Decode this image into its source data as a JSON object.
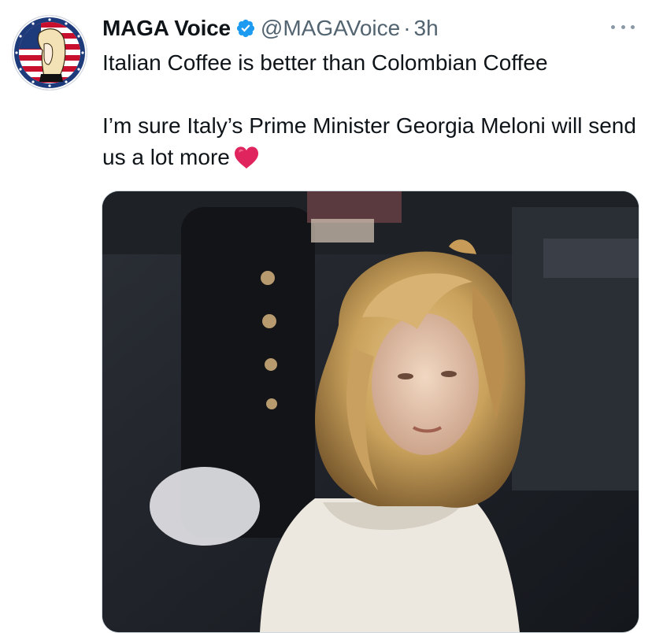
{
  "tweet": {
    "author": {
      "display_name": "MAGA Voice",
      "handle": "@MAGAVoice",
      "verified": true,
      "avatar_icon": "flag-portrait-avatar"
    },
    "separator": "·",
    "timestamp": "3h",
    "more_icon": "more-dots-icon",
    "text_line_1": "Italian Coffee is better than Colombian Coffee",
    "text_line_2": "I’m sure Italy’s Prime Minister Georgia Meloni will send us a lot more",
    "emoji": "red-heart-icon",
    "media": {
      "type": "video-still"
    }
  },
  "colors": {
    "verified_blue": "#1d9bf0",
    "text_primary": "#0f1419",
    "text_secondary": "#536471",
    "heart_red": "#e0245e"
  }
}
